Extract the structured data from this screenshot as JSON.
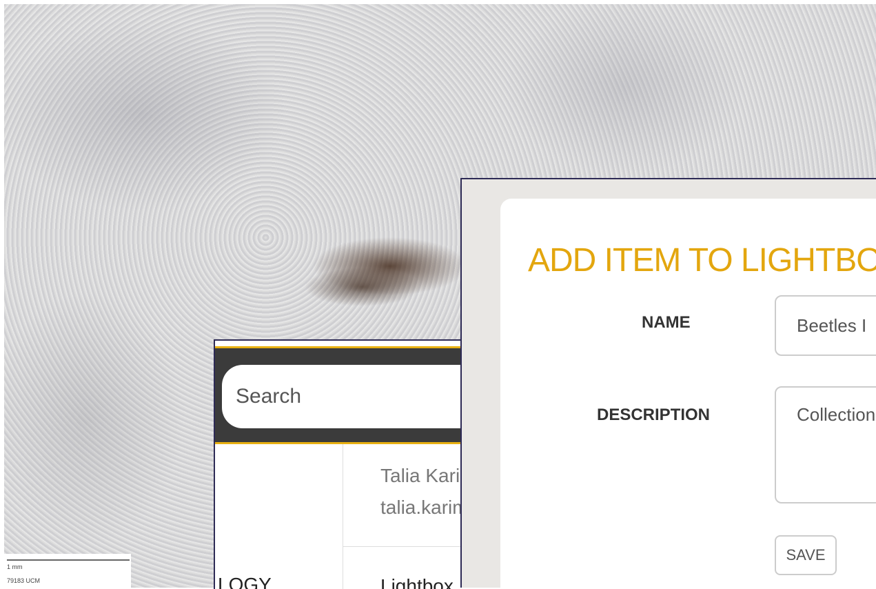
{
  "background": {
    "scale_label": "1 mm",
    "specimen_label": "79183 UCM"
  },
  "search_panel": {
    "placeholder": "Search",
    "user_name": "Talia Karim",
    "user_email": "talia.karim",
    "nav_partial": "LOGY",
    "nav_lightbox": "Lightbox"
  },
  "modal": {
    "title": "ADD ITEM TO LIGHTBOX",
    "name_label": "NAME",
    "name_value": "Beetles I",
    "description_label": "DESCRIPTION",
    "description_value": "Collection",
    "save_label": "SAVE"
  },
  "colors": {
    "accent": "#e3a60e",
    "header_bg": "#3b3b3b",
    "frame_border": "#2d2a55"
  }
}
